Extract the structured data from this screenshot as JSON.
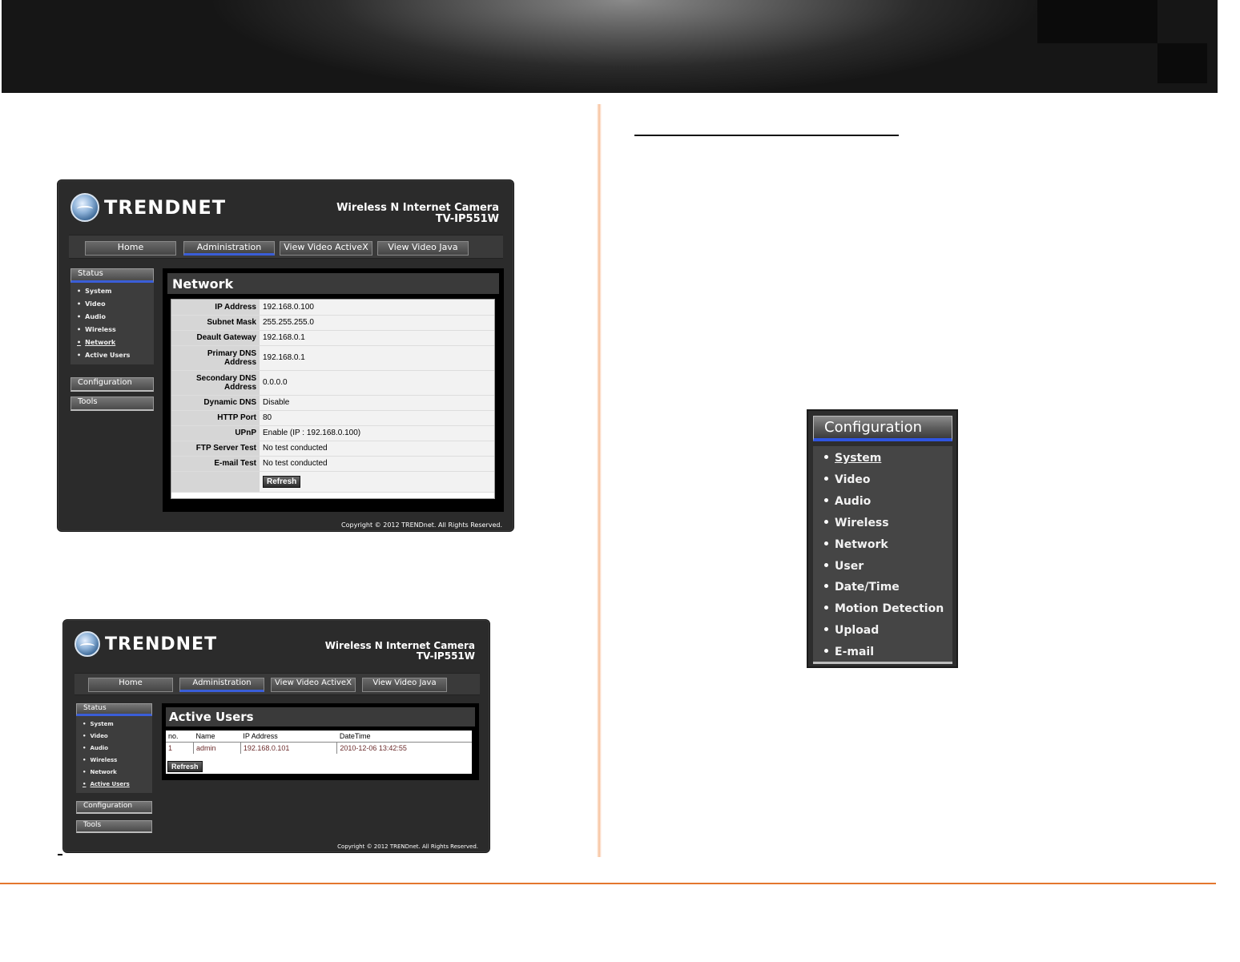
{
  "brand": {
    "logo_text": "TRENDNET"
  },
  "camera": {
    "product_name": "Wireless N Internet Camera",
    "model": "TV-IP551W"
  },
  "nav": {
    "home": "Home",
    "administration": "Administration",
    "view_activex": "View Video   ActiveX",
    "view_java": "View Video   Java"
  },
  "sidebar": {
    "status": "Status",
    "configuration": "Configuration",
    "tools": "Tools",
    "status_items": [
      "System",
      "Video",
      "Audio",
      "Wireless",
      "Network",
      "Active Users"
    ]
  },
  "network_panel": {
    "title": "Network",
    "rows": [
      {
        "key": "IP Address",
        "value": "192.168.0.100"
      },
      {
        "key": "Subnet Mask",
        "value": "255.255.255.0"
      },
      {
        "key": "Deault Gateway",
        "value": "192.168.0.1"
      },
      {
        "key": "Primary DNS Address",
        "value": "192.168.0.1"
      },
      {
        "key": "Secondary DNS Address",
        "value": "0.0.0.0"
      },
      {
        "key": "Dynamic DNS",
        "value": "Disable"
      },
      {
        "key": "HTTP Port",
        "value": "80"
      },
      {
        "key": "UPnP",
        "value": "Enable (IP : 192.168.0.100)"
      },
      {
        "key": "FTP Server Test",
        "value": "No test conducted"
      },
      {
        "key": "E-mail Test",
        "value": "No test conducted"
      }
    ],
    "refresh": "Refresh"
  },
  "active_users_panel": {
    "title": "Active Users",
    "columns": [
      "no.",
      "Name",
      "IP Address",
      "DateTime"
    ],
    "rows": [
      {
        "no": "1",
        "name": "admin",
        "ip": "192.168.0.101",
        "datetime": "2010-12-06 13:42:55"
      }
    ],
    "refresh": "Refresh"
  },
  "copyright": "Copyright © 2012 TRENDnet.  All Rights Reserved.",
  "config_menu": {
    "title": "Configuration",
    "items": [
      "System",
      "Video",
      "Audio",
      "Wireless",
      "Network",
      "User",
      "Date/Time",
      "Motion Detection",
      "Upload",
      "E-mail"
    ]
  },
  "colors": {
    "accent_orange": "#e4772e",
    "nav_blue": "#3a5ed8"
  }
}
